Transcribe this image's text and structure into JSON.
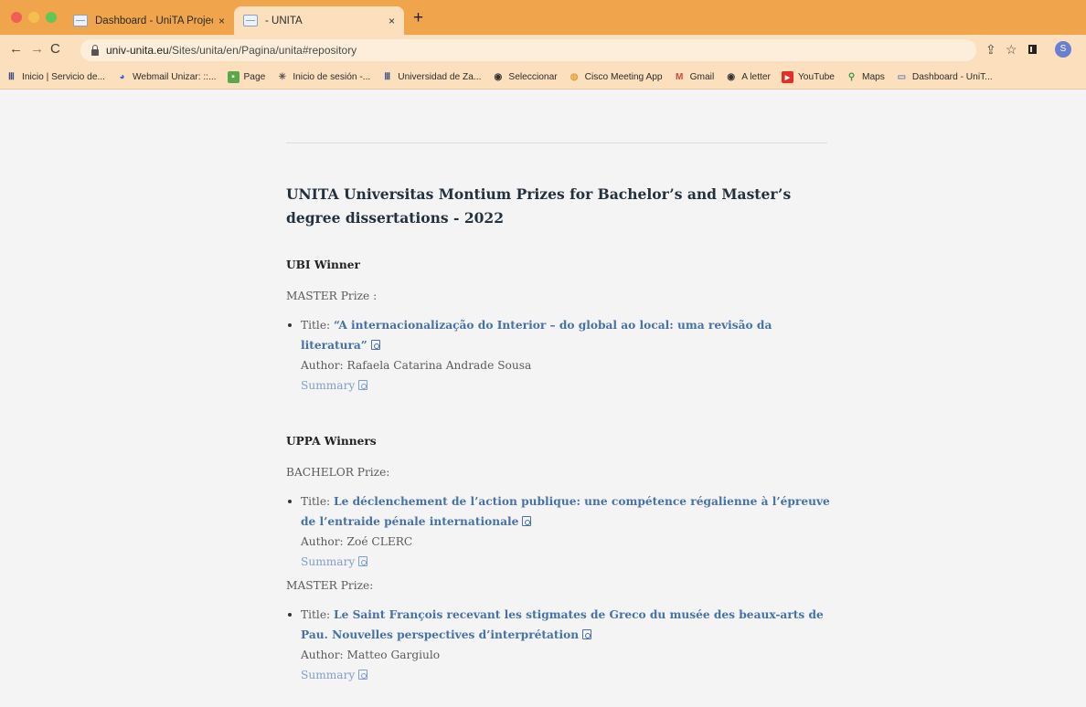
{
  "browser": {
    "tabs": [
      {
        "title": "Dashboard - UniTA Project Dat",
        "close": "×"
      },
      {
        "title": "- UNITA",
        "close": "×"
      }
    ],
    "newtab": "+",
    "url_host": "univ-unita.eu",
    "url_path": "/Sites/unita/en/Pagina/unita#repository",
    "profile_initial": "S",
    "colors": {
      "tabstrip": "#f0a54c",
      "toolbar": "#fce0bd"
    }
  },
  "bookmarks": [
    {
      "label": "Inicio | Servicio de...",
      "icon": "university-icon"
    },
    {
      "label": "Webmail Unizar: ::...",
      "icon": "webmail-icon"
    },
    {
      "label": "Page",
      "icon": "page-icon"
    },
    {
      "label": "Inicio de sesión -...",
      "icon": "login-icon"
    },
    {
      "label": "Universidad de Za...",
      "icon": "university-icon"
    },
    {
      "label": "Seleccionar",
      "icon": "globe-icon"
    },
    {
      "label": "Cisco Meeting App",
      "icon": "cisco-icon"
    },
    {
      "label": "Gmail",
      "icon": "gmail-icon"
    },
    {
      "label": "A letter",
      "icon": "globe-icon"
    },
    {
      "label": "YouTube",
      "icon": "youtube-icon"
    },
    {
      "label": "Maps",
      "icon": "maps-icon"
    },
    {
      "label": "Dashboard - UniT...",
      "icon": "dashboard-icon"
    }
  ],
  "page": {
    "heading": "UNITA Universitas Montium Prizes for Bachelor’s and Master’s degree dissertations - 2022",
    "sections": [
      {
        "name": "UBI Winner",
        "prizes": [
          {
            "label": "MASTER Prize :",
            "title_prefix": "Title: ",
            "title": "“A internacionalização do Interior – do global ao local: uma revisão da literatura”",
            "author": "Author: Rafaela Catarina Andrade Sousa",
            "summary": "Summary"
          }
        ]
      },
      {
        "name": "UPPA Winners",
        "prizes": [
          {
            "label": "BACHELOR Prize:",
            "title_prefix": "Title: ",
            "title": "Le déclenchement de l’action publique: une compétence régalienne à l’épreuve de l’entraide pénale internationale",
            "author": "Author: Zoé CLERC",
            "summary": "Summary"
          },
          {
            "label": "MASTER Prize:",
            "title_prefix": "Title: ",
            "title": "Le Saint François recevant les stigmates de Greco du musée des beaux-arts de Pau. Nouvelles perspectives d’interprétation",
            "author": "Author: Matteo Gargiulo",
            "summary": "Summary"
          }
        ]
      }
    ]
  }
}
